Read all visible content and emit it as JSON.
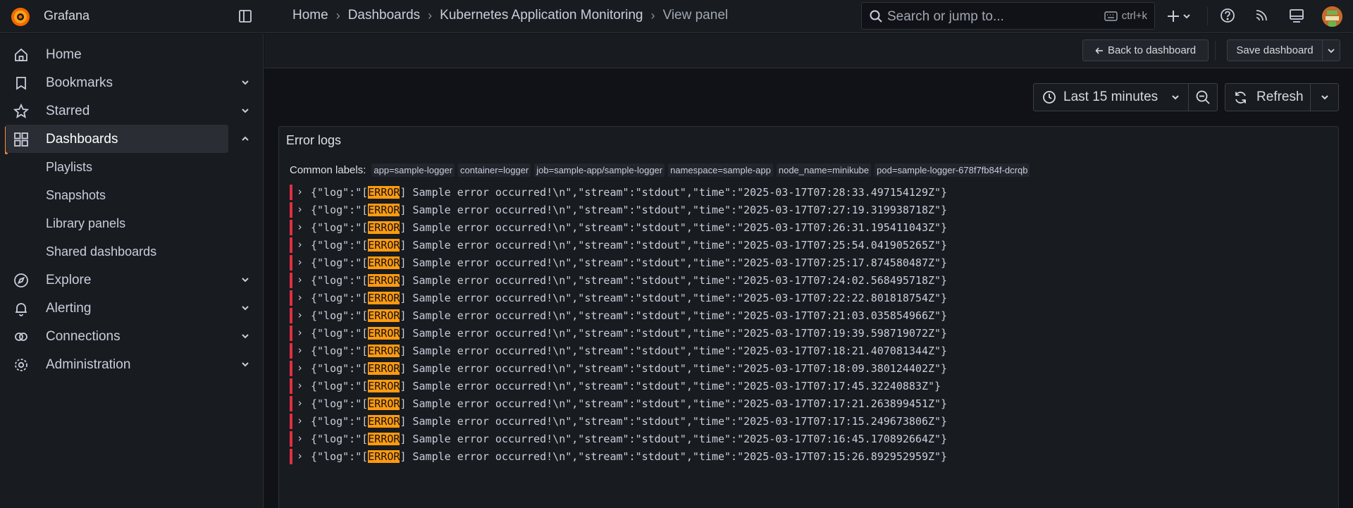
{
  "app": {
    "brand": "Grafana"
  },
  "breadcrumbs": [
    {
      "label": "Home"
    },
    {
      "label": "Dashboards"
    },
    {
      "label": "Kubernetes Application Monitoring"
    },
    {
      "label": "View panel"
    }
  ],
  "search": {
    "placeholder": "Search or jump to...",
    "shortcut": "ctrl+k"
  },
  "sidebar": {
    "items": [
      {
        "label": "Home",
        "icon": "home-icon"
      },
      {
        "label": "Bookmarks",
        "icon": "bookmark-icon"
      },
      {
        "label": "Starred",
        "icon": "star-icon"
      },
      {
        "label": "Dashboards",
        "icon": "apps-icon"
      },
      {
        "label": "Explore",
        "icon": "compass-icon"
      },
      {
        "label": "Alerting",
        "icon": "bell-icon"
      },
      {
        "label": "Connections",
        "icon": "link-icon"
      },
      {
        "label": "Administration",
        "icon": "cog-icon"
      }
    ],
    "dashboards_children": [
      "Playlists",
      "Snapshots",
      "Library panels",
      "Shared dashboards"
    ]
  },
  "toolbar": {
    "back_label": "Back to dashboard",
    "save_label": "Save dashboard",
    "time_range": "Last 15 minutes",
    "refresh_label": "Refresh"
  },
  "panel": {
    "title": "Error logs",
    "common_labels_title": "Common labels:",
    "common_labels": [
      "app=sample-logger",
      "container=logger",
      "job=sample-app/sample-logger",
      "namespace=sample-app",
      "node_name=minikube",
      "pod=sample-logger-678f7fb84f-dcrqb"
    ],
    "highlight_term": "ERROR",
    "log_prefix": "{\"log\":\"[",
    "log_suffix": "] Sample error occurred!\\n\",\"stream\":\"stdout\",\"time\":\"",
    "log_end": "\"}",
    "times": [
      "2025-03-17T07:28:33.497154129Z",
      "2025-03-17T07:27:19.319938718Z",
      "2025-03-17T07:26:31.195411043Z",
      "2025-03-17T07:25:54.041905265Z",
      "2025-03-17T07:25:17.874580487Z",
      "2025-03-17T07:24:02.568495718Z",
      "2025-03-17T07:22:22.801818754Z",
      "2025-03-17T07:21:03.035854966Z",
      "2025-03-17T07:19:39.598719072Z",
      "2025-03-17T07:18:21.407081344Z",
      "2025-03-17T07:18:09.380124402Z",
      "2025-03-17T07:17:45.32240883Z",
      "2025-03-17T07:17:21.263899451Z",
      "2025-03-17T07:17:15.249673806Z",
      "2025-03-17T07:16:45.170892664Z",
      "2025-03-17T07:15:26.892952959Z"
    ]
  },
  "colors": {
    "accent": "#ff8a3d",
    "error": "#e02f44",
    "highlight": "#ff9a0f"
  }
}
